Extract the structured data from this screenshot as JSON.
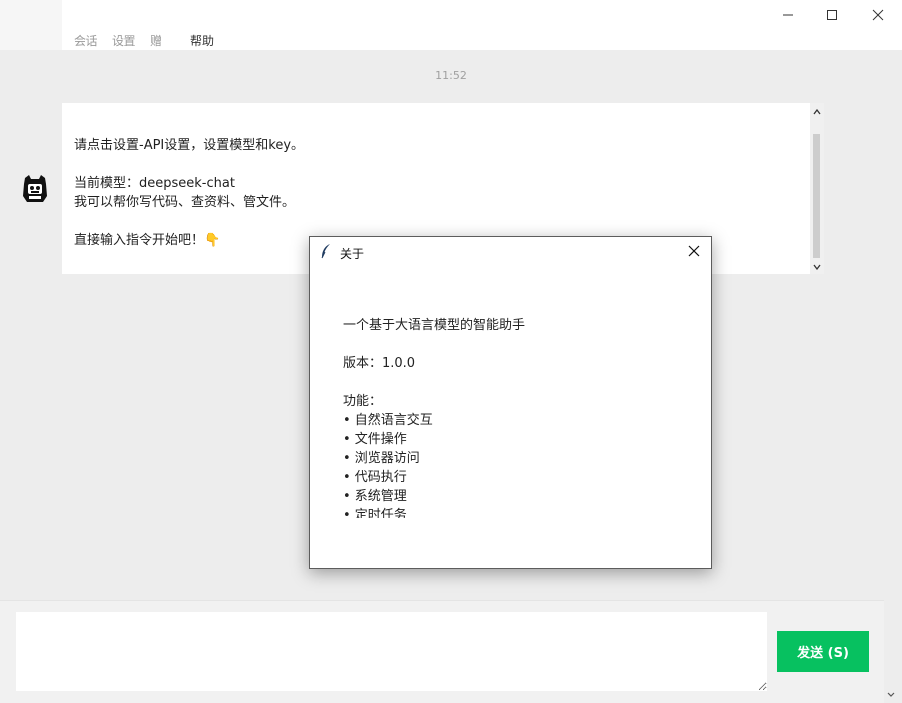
{
  "window": {
    "menus": [
      "会话",
      "设置",
      "帮助"
    ],
    "controls": [
      "minimize",
      "maximize",
      "close"
    ]
  },
  "chat": {
    "timestamp": "11:52",
    "message": {
      "line1": "请点击设置-API设置，设置模型和key。",
      "line2": "当前模型：deepseek-chat",
      "line3": "我可以帮你写代码、查资料、管文件。",
      "line4": "直接输入指令开始吧！👇"
    }
  },
  "input": {
    "placeholder": "",
    "send_label": "发送 (S)"
  },
  "about_dialog": {
    "title": "关于",
    "description": "一个基于大语言模型的智能助手",
    "version": "版本：1.0.0",
    "features_heading": "功能：",
    "features": [
      "• 自然语言交互",
      "• 文件操作",
      "• 浏览器访问",
      "• 代码执行",
      "• 系统管理",
      "• 定时任务"
    ]
  },
  "colors": {
    "send_button": "#07c160",
    "background": "#ededed",
    "bubble": "#ffffff"
  }
}
